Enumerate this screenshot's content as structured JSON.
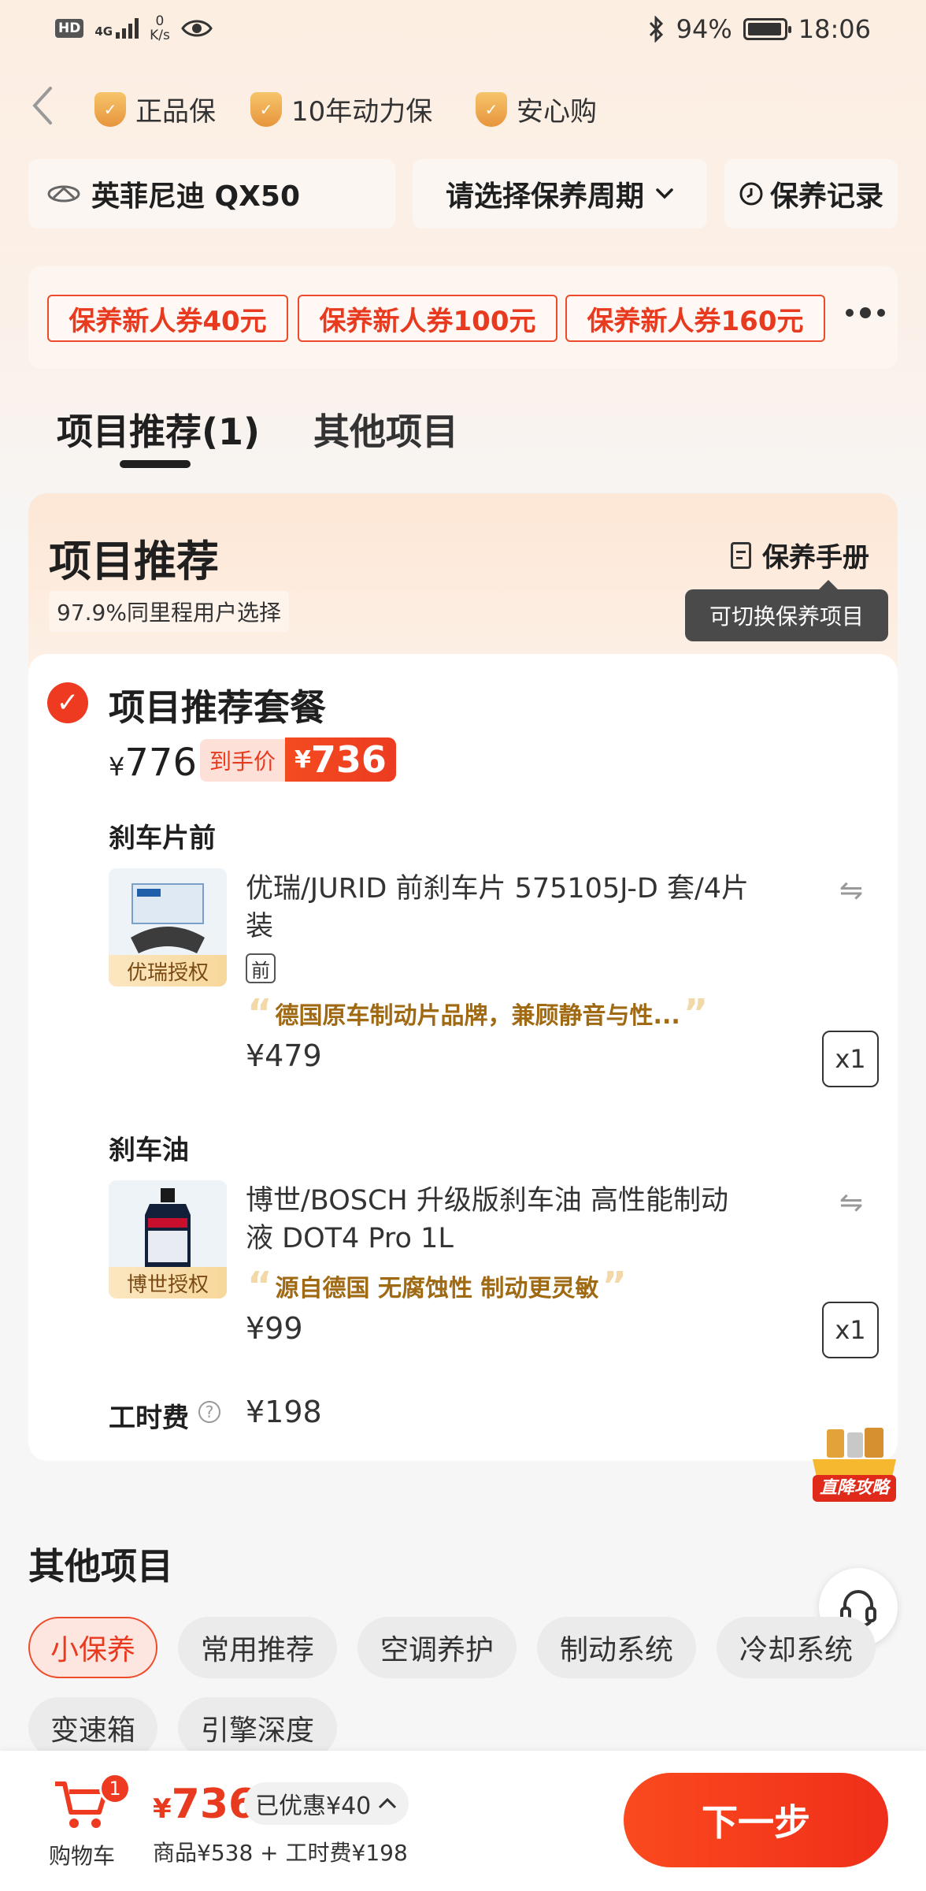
{
  "status_bar": {
    "hd": "HD",
    "network": "4G",
    "speed_value": "0",
    "speed_unit": "K/s",
    "battery": "94%",
    "time": "18:06"
  },
  "guarantees": [
    "正品保",
    "10年动力保",
    "安心购"
  ],
  "selectors": {
    "car": "英菲尼迪 QX50",
    "cycle": "请选择保养周期",
    "record": "保养记录"
  },
  "coupons": [
    "保养新人券40元",
    "保养新人券100元",
    "保养新人券160元"
  ],
  "tabs": [
    "项目推荐(1)",
    "其他项目"
  ],
  "recommend": {
    "title": "项目推荐",
    "subtitle": "97.9%同里程用户选择",
    "manual": "保养手册",
    "tooltip": "可切换保养项目"
  },
  "package": {
    "title": "项目推荐套餐",
    "currency": "¥",
    "original_price": "776",
    "final_label": "到手价",
    "final_price": "736"
  },
  "items": [
    {
      "section": "刹车片前",
      "tag": "优瑞授权",
      "name_line1": "优瑞/JURID 前刹车片 575105J-D 套/4片",
      "name_line2": "装",
      "position_tag": "前",
      "quote": "德国原车制动片品牌，兼顾静音与性...",
      "price": "¥479",
      "qty": "x1"
    },
    {
      "section": "刹车油",
      "tag": "博世授权",
      "name_line1": "博世/BOSCH 升级版刹车油 高性能制动",
      "name_line2": "液 DOT4 Pro 1L",
      "quote": "源自德国 无腐蚀性 制动更灵敏",
      "price": "¥99",
      "qty": "x1"
    }
  ],
  "labor": {
    "label": "工时费",
    "help": "?",
    "price": "¥198"
  },
  "promo_float": "直降攻略",
  "other": {
    "title": "其他项目",
    "pills": [
      "小保养",
      "常用推荐",
      "空调养护",
      "制动系统",
      "冷却系统",
      "变速箱",
      "引擎深度"
    ]
  },
  "bottom": {
    "cart_count": "1",
    "cart_label": "购物车",
    "currency": "¥",
    "total": "736",
    "saved": "已优惠¥40",
    "breakdown": "商品¥538 + 工时费¥198",
    "next": "下一步"
  },
  "colors": {
    "accent": "#ee3a20",
    "gold": "#a06a14"
  }
}
